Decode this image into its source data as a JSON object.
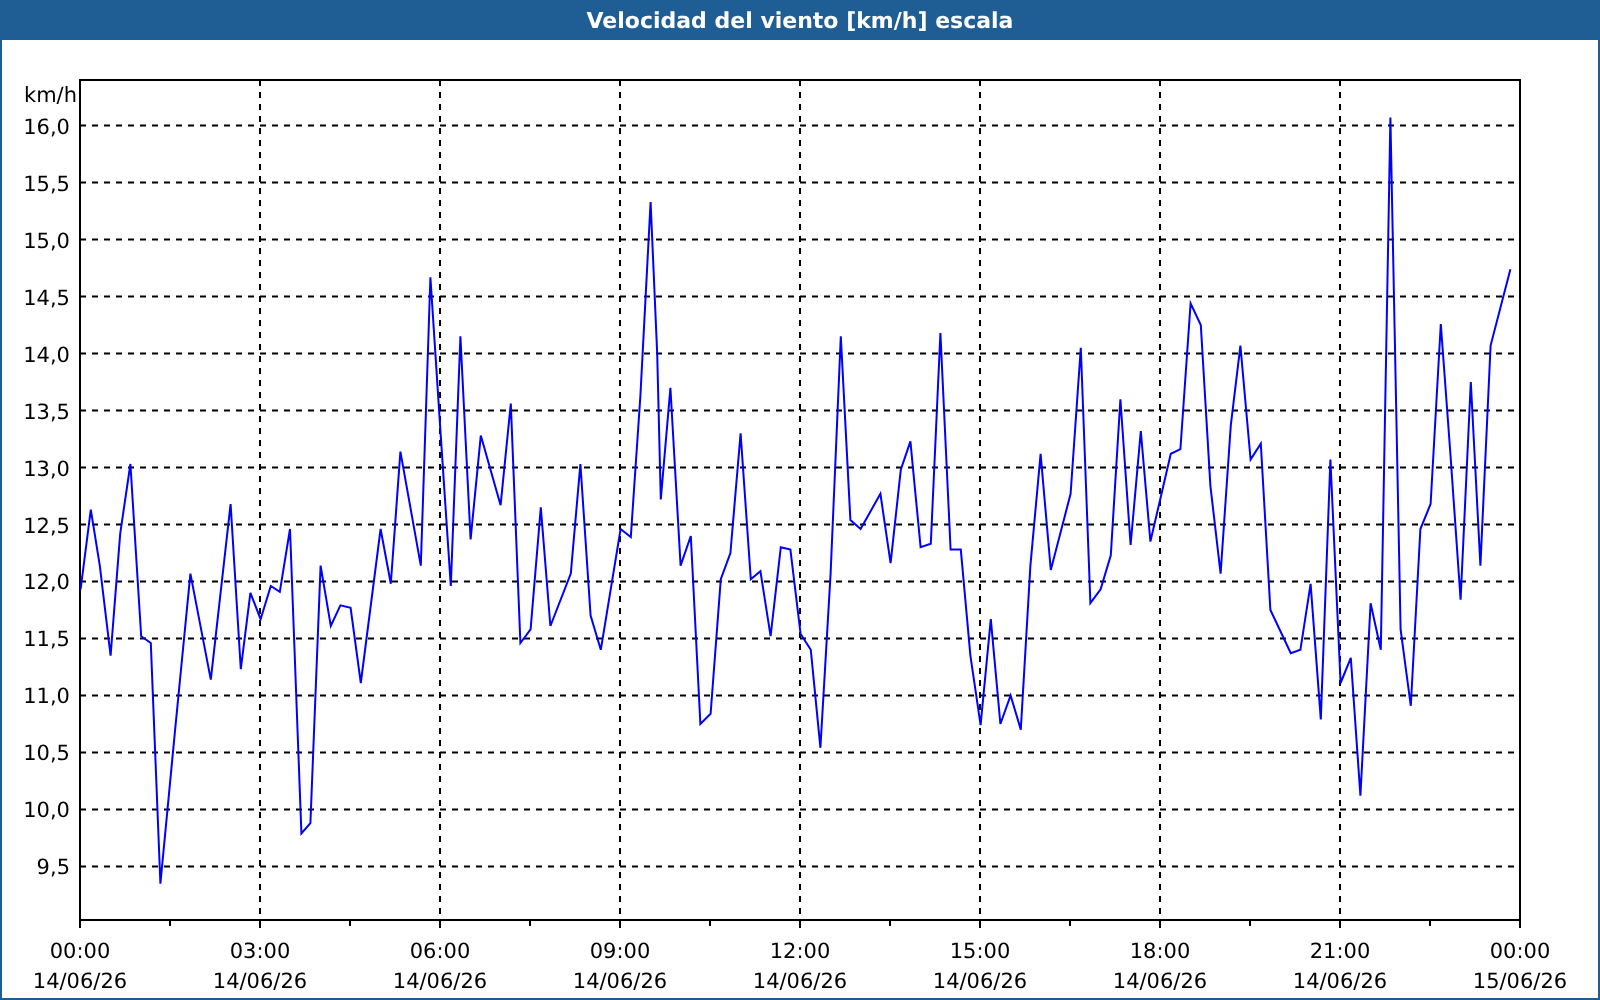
{
  "window": {
    "title": "Velocidad del viento [km/h] escala"
  },
  "x_axis_dates": [
    "14/06/26",
    "14/06/26",
    "14/06/26",
    "14/06/26",
    "14/06/26",
    "14/06/26",
    "14/06/26",
    "14/06/26",
    "15/06/26"
  ],
  "chart_data": {
    "type": "line",
    "ylabel": "km/h",
    "xlim": [
      0,
      24
    ],
    "ylim": [
      9.03,
      16.4
    ],
    "yticks": [
      {
        "value": 9.5,
        "label": "9,5"
      },
      {
        "value": 10,
        "label": "10,0"
      },
      {
        "value": 10.5,
        "label": "10,5"
      },
      {
        "value": 11,
        "label": "11,0"
      },
      {
        "value": 11.5,
        "label": "11,5"
      },
      {
        "value": 12,
        "label": "12,0"
      },
      {
        "value": 12.5,
        "label": "12,5"
      },
      {
        "value": 13,
        "label": "13,0"
      },
      {
        "value": 13.5,
        "label": "13,5"
      },
      {
        "value": 14,
        "label": "14,0"
      },
      {
        "value": 14.5,
        "label": "14,5"
      },
      {
        "value": 15,
        "label": "15,0"
      },
      {
        "value": 15.5,
        "label": "15,5"
      },
      {
        "value": 16,
        "label": "16,0"
      }
    ],
    "xticks": [
      {
        "value": 0,
        "label": "00:00"
      },
      {
        "value": 3,
        "label": "03:00"
      },
      {
        "value": 6,
        "label": "06:00"
      },
      {
        "value": 9,
        "label": "09:00"
      },
      {
        "value": 12,
        "label": "12:00"
      },
      {
        "value": 15,
        "label": "15:00"
      },
      {
        "value": 18,
        "label": "18:00"
      },
      {
        "value": 21,
        "label": "21:00"
      },
      {
        "value": 24,
        "label": "00:00"
      }
    ],
    "grid": true,
    "x": [
      0.01,
      0.18,
      0.33,
      0.51,
      0.67,
      0.84,
      0.96,
      1.02,
      1.18,
      1.34,
      1.58,
      1.84,
      2.18,
      2.51,
      2.68,
      2.84,
      3.01,
      3.18,
      3.33,
      3.5,
      3.69,
      3.84,
      4.01,
      4.18,
      4.34,
      4.51,
      4.68,
      5.01,
      5.18,
      5.34,
      5.68,
      5.84,
      6.01,
      6.18,
      6.34,
      6.51,
      6.68,
      7.01,
      7.18,
      7.34,
      7.51,
      7.68,
      7.84,
      8.18,
      8.34,
      8.51,
      8.68,
      9.01,
      9.18,
      9.34,
      9.51,
      9.62,
      9.68,
      9.84,
      10.01,
      10.18,
      10.34,
      10.51,
      10.68,
      10.84,
      11.01,
      11.18,
      11.34,
      11.51,
      11.68,
      11.84,
      12.01,
      12.18,
      12.34,
      12.51,
      12.68,
      12.84,
      13.01,
      13.34,
      13.51,
      13.68,
      13.84,
      14.01,
      14.18,
      14.34,
      14.51,
      14.68,
      14.84,
      15.01,
      15.18,
      15.34,
      15.51,
      15.68,
      15.84,
      16.01,
      16.18,
      16.51,
      16.68,
      16.84,
      17.01,
      17.18,
      17.34,
      17.51,
      17.68,
      17.84,
      18.18,
      18.34,
      18.51,
      18.68,
      18.84,
      19.01,
      19.18,
      19.34,
      19.51,
      19.68,
      19.84,
      20.18,
      20.34,
      20.51,
      20.68,
      20.84,
      21.01,
      21.18,
      21.34,
      21.51,
      21.68,
      21.84,
      22.01,
      22.18,
      22.34,
      22.51,
      22.68,
      22.84,
      23.01,
      23.18,
      23.34,
      23.51,
      23.84
    ],
    "series": [
      {
        "color": "#0000ff",
        "values": [
          11.93,
          12.63,
          12.14,
          11.35,
          12.42,
          13.03,
          12.02,
          11.52,
          11.46,
          9.35,
          10.67,
          12.07,
          11.14,
          12.68,
          11.23,
          11.9,
          11.67,
          11.96,
          11.91,
          12.46,
          9.79,
          9.88,
          12.14,
          11.61,
          11.79,
          11.77,
          11.11,
          12.46,
          11.98,
          13.14,
          12.14,
          14.67,
          13.3,
          11.96,
          14.15,
          12.37,
          13.28,
          12.67,
          13.56,
          11.46,
          11.58,
          12.65,
          11.61,
          12.07,
          13.03,
          11.7,
          11.4,
          12.46,
          12.39,
          13.63,
          15.33,
          14.0,
          12.72,
          13.7,
          12.14,
          12.4,
          10.75,
          10.84,
          12.02,
          12.25,
          13.3,
          12.02,
          12.09,
          11.52,
          12.3,
          12.28,
          11.54,
          11.4,
          10.54,
          12.07,
          14.15,
          12.54,
          12.46,
          12.77,
          12.16,
          12.98,
          13.23,
          12.3,
          12.33,
          14.18,
          12.28,
          12.28,
          11.35,
          10.74,
          11.67,
          10.75,
          11.0,
          10.7,
          12.14,
          13.12,
          12.1,
          12.77,
          14.05,
          11.81,
          11.93,
          12.23,
          13.6,
          12.32,
          13.32,
          12.35,
          13.12,
          13.16,
          14.44,
          14.25,
          12.84,
          12.07,
          13.37,
          14.07,
          13.07,
          13.21,
          11.75,
          11.37,
          11.4,
          11.98,
          10.79,
          13.07,
          11.11,
          11.33,
          10.12,
          11.81,
          11.4,
          16.07,
          11.58,
          10.91,
          12.46,
          12.68,
          14.26,
          13.12,
          11.84,
          13.75,
          12.14,
          14.07,
          14.74
        ]
      }
    ]
  }
}
